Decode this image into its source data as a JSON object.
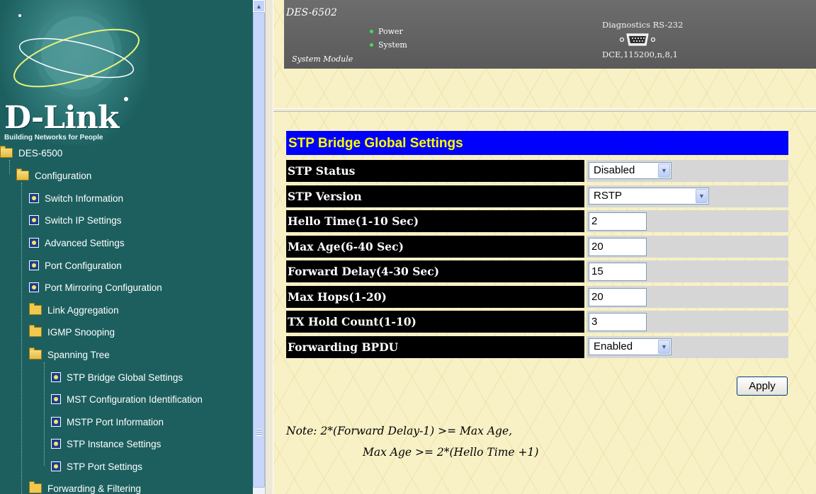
{
  "sidebar": {
    "brand": "D-Link",
    "tagline": "Building Networks for People",
    "tree": [
      {
        "label": "DES-6500",
        "icon": "folder-open-icon",
        "level": 0
      },
      {
        "label": "Configuration",
        "icon": "folder-open-icon",
        "level": 1
      },
      {
        "label": "Switch Information",
        "icon": "page-icon",
        "level": 2
      },
      {
        "label": "Switch IP Settings",
        "icon": "page-icon",
        "level": 2
      },
      {
        "label": "Advanced Settings",
        "icon": "page-icon",
        "level": 2
      },
      {
        "label": "Port Configuration",
        "icon": "page-icon",
        "level": 2
      },
      {
        "label": "Port Mirroring Configuration",
        "icon": "page-icon",
        "level": 2
      },
      {
        "label": "Link Aggregation",
        "icon": "folder-icon",
        "level": 2
      },
      {
        "label": "IGMP Snooping",
        "icon": "folder-icon",
        "level": 2
      },
      {
        "label": "Spanning Tree",
        "icon": "folder-open-icon",
        "level": 2
      },
      {
        "label": "STP Bridge Global Settings",
        "icon": "page-icon",
        "level": 3
      },
      {
        "label": "MST Configuration Identification",
        "icon": "page-icon",
        "level": 3
      },
      {
        "label": "MSTP Port Information",
        "icon": "page-icon",
        "level": 3
      },
      {
        "label": "STP Instance Settings",
        "icon": "page-icon",
        "level": 3
      },
      {
        "label": "STP Port Settings",
        "icon": "page-icon",
        "level": 3
      },
      {
        "label": "Forwarding & Filtering",
        "icon": "folder-icon",
        "level": 2
      }
    ]
  },
  "device": {
    "model": "DES-6502",
    "leds": [
      "Power",
      "System"
    ],
    "module": "System Module",
    "diag_label": "Diagnostics RS-232",
    "diag_settings": "DCE,115200,n,8,1"
  },
  "settings": {
    "title": "STP Bridge Global Settings",
    "rows": [
      {
        "label": "STP Status",
        "type": "select",
        "value": "Disabled"
      },
      {
        "label": "STP Version",
        "type": "select",
        "value": "RSTP"
      },
      {
        "label": "Hello Time(1-10 Sec)",
        "type": "input",
        "value": "2"
      },
      {
        "label": "Max Age(6-40 Sec)",
        "type": "input",
        "value": "20"
      },
      {
        "label": "Forward Delay(4-30 Sec)",
        "type": "input",
        "value": "15"
      },
      {
        "label": "Max Hops(1-20)",
        "type": "input",
        "value": "20"
      },
      {
        "label": "TX Hold Count(1-10)",
        "type": "input",
        "value": "3"
      },
      {
        "label": "Forwarding BPDU",
        "type": "select",
        "value": "Enabled"
      }
    ],
    "apply_label": "Apply",
    "note_line1": "Note: 2*(Forward Delay-1) >= Max Age,",
    "note_line2": "Max Age >= 2*(Hello Time +1)"
  },
  "colors": {
    "sidebar_bg": "#1d5f5f",
    "title_bar": "#0000ff",
    "title_text": "#ffff00",
    "label_bg": "#000000"
  }
}
